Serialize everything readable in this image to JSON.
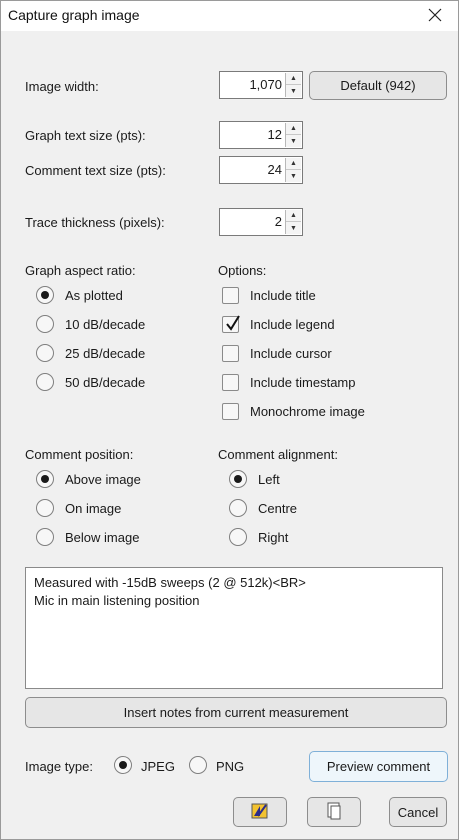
{
  "window": {
    "title": "Capture graph image",
    "close_icon": "close-icon"
  },
  "image_width": {
    "label": "Image width:",
    "value": "1,070",
    "default_button": "Default (942)"
  },
  "graph_text_size": {
    "label": "Graph text size (pts):",
    "value": "12"
  },
  "comment_text_size": {
    "label": "Comment text size (pts):",
    "value": "24"
  },
  "trace_thickness": {
    "label": "Trace thickness (pixels):",
    "value": "2"
  },
  "aspect_ratio": {
    "label": "Graph aspect ratio:",
    "options": [
      "As plotted",
      "10 dB/decade",
      "25 dB/decade",
      "50 dB/decade"
    ],
    "selected": "As plotted"
  },
  "options": {
    "label": "Options:",
    "items": [
      {
        "label": "Include title",
        "checked": false
      },
      {
        "label": "Include legend",
        "checked": true
      },
      {
        "label": "Include cursor",
        "checked": false
      },
      {
        "label": "Include timestamp",
        "checked": false
      },
      {
        "label": "Monochrome image",
        "checked": false
      }
    ]
  },
  "comment_position": {
    "label": "Comment position:",
    "options": [
      "Above image",
      "On image",
      "Below image"
    ],
    "selected": "Above image"
  },
  "comment_alignment": {
    "label": "Comment alignment:",
    "options": [
      "Left",
      "Centre",
      "Right"
    ],
    "selected": "Left"
  },
  "comment_text": {
    "lines": [
      "Measured with -15dB sweeps (2 @ 512k)<BR>",
      "Mic in main listening position"
    ]
  },
  "insert_notes_button": "Insert notes from current measurement",
  "image_type": {
    "label": "Image type:",
    "options": [
      "JPEG",
      "PNG"
    ],
    "selected": "JPEG"
  },
  "preview_button": "Preview comment",
  "footer": {
    "save_icon": "save-image-icon",
    "copy_icon": "copy-clipboard-icon",
    "cancel_button": "Cancel"
  }
}
